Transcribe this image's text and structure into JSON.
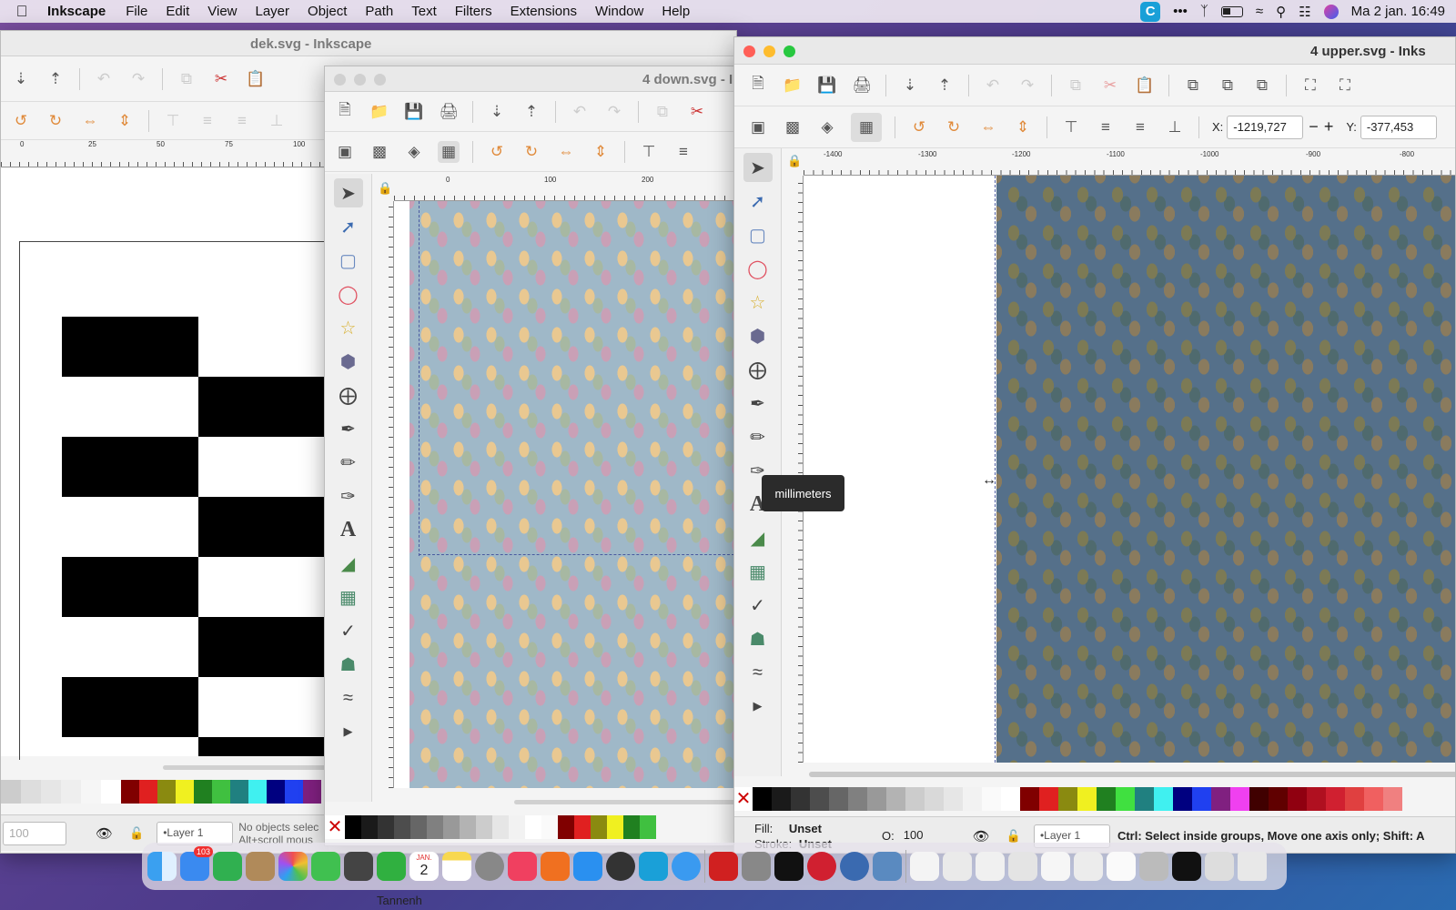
{
  "menubar": {
    "app": "Inkscape",
    "items": [
      "File",
      "Edit",
      "View",
      "Layer",
      "Object",
      "Path",
      "Text",
      "Filters",
      "Extensions",
      "Window",
      "Help"
    ],
    "clock": "Ma 2 jan.  16:49"
  },
  "win_dek": {
    "title": "dek.svg - Inkscape",
    "ruler": [
      "0",
      "25",
      "50",
      "75",
      "100"
    ],
    "zoom": "100",
    "layer": "•Layer 1",
    "status1": "No objects selec",
    "status2": "Alt+scroll mous"
  },
  "win_down": {
    "title": "4 down.svg - I",
    "ruler": [
      "0",
      "100",
      "200"
    ]
  },
  "win_upper": {
    "title": "4 upper.svg - Inks",
    "x_label": "X:",
    "x_value": "-1219,727",
    "y_label": "Y:",
    "y_value": "-377,453",
    "ruler": [
      "-1400",
      "-1300",
      "-1200",
      "-1100",
      "-1000",
      "-900",
      "-800"
    ],
    "fill_label": "Fill:",
    "fill_value": "Unset",
    "stroke_label": "Stroke:",
    "stroke_value": "Unset",
    "opacity_label": "O:",
    "opacity_value": "100",
    "layer": "•Layer 1",
    "status": "Ctrl: Select inside groups, Move one axis only; Shift: A"
  },
  "tooltip": "millimeters",
  "dock": {
    "mail_badge": "103",
    "calendar_day": "2",
    "calendar_month": "JAN.",
    "under_text": "Tannenh"
  },
  "colors": {
    "palette": [
      "#000",
      "#222",
      "#333",
      "#444",
      "#555",
      "#666",
      "#888",
      "#999",
      "#aaa",
      "#bbb",
      "#ccc",
      "#ddd",
      "#eee",
      "#fff",
      "#800000",
      "#e02020",
      "#8a8a10",
      "#f0f020",
      "#208020",
      "#40e040",
      "#208080",
      "#40f0f0",
      "#000080",
      "#2040f0",
      "#802080",
      "#f040f0",
      "#400000",
      "#600000",
      "#900010",
      "#b01020",
      "#d02030",
      "#e04040",
      "#f06060",
      "#f08080"
    ]
  }
}
